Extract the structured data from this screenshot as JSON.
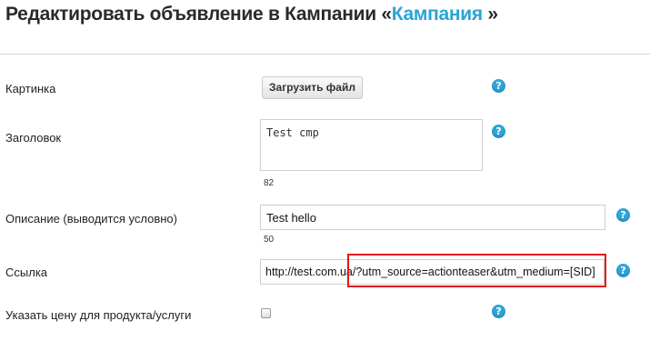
{
  "header": {
    "title_prefix": "Редактировать объявление в Кампании «",
    "campaign_link": "Кампания",
    "title_suffix": " »"
  },
  "form": {
    "image": {
      "label": "Картинка",
      "button_label": "Загрузить файл",
      "help": "?"
    },
    "heading": {
      "label": "Заголовок",
      "value": "Test cmp",
      "counter": "82",
      "help": "?"
    },
    "description": {
      "label": "Описание (выводится условно)",
      "value": "Test hello",
      "counter": "50",
      "help": "?"
    },
    "link": {
      "label": "Ссылка",
      "value": "http://test.com.ua/?utm_source=actionteaser&utm_medium=[SID]",
      "help": "?"
    },
    "price": {
      "label": "Указать цену для продукта/услуги",
      "checked": false,
      "help": "?"
    }
  },
  "colors": {
    "accent": "#2aa3d5",
    "help_icon": "#2fa6db",
    "highlight": "#e01b1b"
  }
}
